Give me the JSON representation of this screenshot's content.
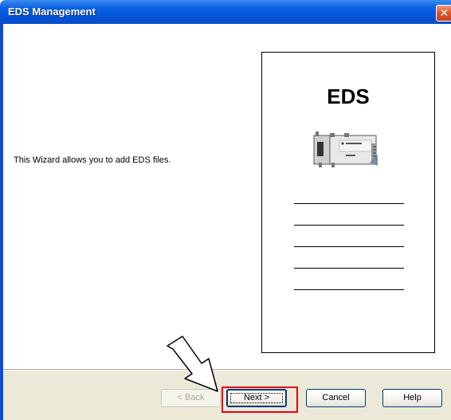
{
  "window": {
    "title": "EDS Management",
    "close_icon": "close-icon"
  },
  "main": {
    "intro": "This Wizard allows you to add EDS files."
  },
  "illustration": {
    "doc_title": "EDS",
    "device_icon": "network-module-icon",
    "line_count": 5
  },
  "annotation": {
    "arrow_icon": "pointer-arrow-icon",
    "highlight_color": "#e60012"
  },
  "buttons": {
    "back": "< Back",
    "next": "Next >",
    "cancel": "Cancel",
    "help": "Help"
  },
  "colors": {
    "titlebar": "#0a5fe0",
    "dialog_bg": "#ece9d8",
    "close": "#e2582e"
  }
}
